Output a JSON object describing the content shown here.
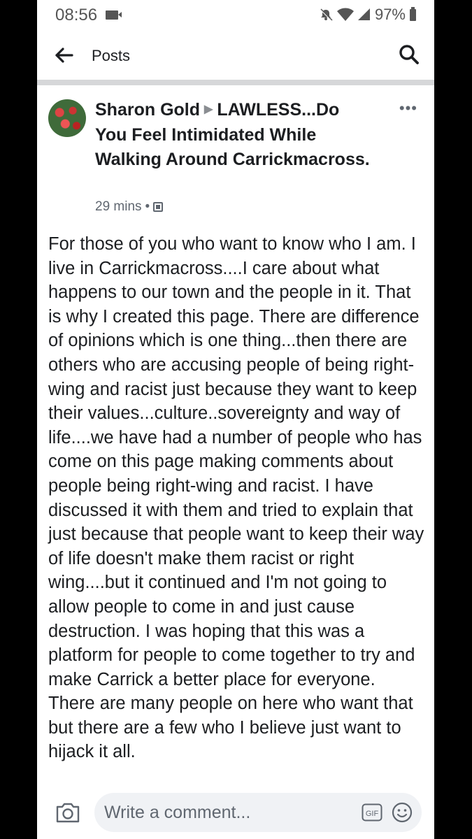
{
  "status_bar": {
    "time": "08:56",
    "battery": "97%"
  },
  "app_bar": {
    "title": "Posts"
  },
  "post": {
    "author": "Sharon Gold",
    "group": "LAWLESS...Do You Feel Intimidated While Walking Around Carrickmacross.",
    "time": "29 mins",
    "separator": "•",
    "body": "For those of you who want to know who I am. I live in Carrickmacross....I care about what happens to our town and the people in it. That is why I created this page.   There are difference of opinions which is one thing...then there are others who are accusing people of being right-wing and racist just because they want to keep their values...culture..sovereignty and way of life....we have had a number of people who has come on this page making comments about people being right-wing and racist.  I have discussed it with them and tried to explain that just because that people want to keep their way of life doesn't make them racist or right wing....but it continued and I'm not going to allow people to come in and just cause destruction.  I was hoping that this was a platform for people to come together to try and make Carrick a better place for everyone.   There are many people on here who want that but there are a few who I believe just want to hijack it all."
  },
  "composer": {
    "placeholder": "Write a comment...",
    "gif_label": "GIF"
  },
  "icons": {
    "back": "arrow-left-icon",
    "search": "search-icon",
    "more": "more-icon",
    "camera": "camera-icon",
    "gif": "gif-icon",
    "emoji": "emoji-icon"
  },
  "colors": {
    "text": "#1c1e21",
    "secondary": "#606770",
    "composer_bg": "#f0f2f5"
  }
}
